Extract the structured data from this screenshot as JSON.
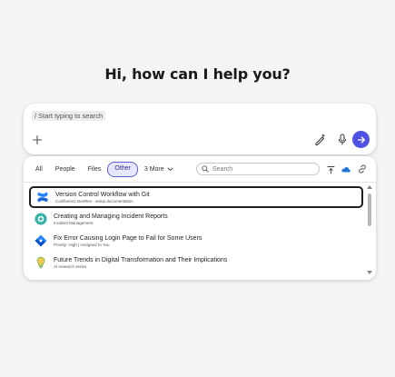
{
  "greeting": "Hi, how can I help you?",
  "composer": {
    "prompt_text": "/ Start typing to search",
    "add_icon": "plus-icon",
    "pen_icon": "pen-sparkle-icon",
    "mic_icon": "microphone-icon",
    "send_icon": "arrow-right-icon",
    "send_color": "#4f52e3"
  },
  "filters": {
    "tabs": [
      "All",
      "People",
      "Files",
      "Other"
    ],
    "active_tab": "Other",
    "more_label": "3 More",
    "search_placeholder": "Search",
    "accent": "#5b5fd6"
  },
  "results": [
    {
      "icon": "confluence-icon",
      "title": "Version Control Workflow with Git",
      "subtitle": "Confluence DevRes - setup documentation",
      "selected": true
    },
    {
      "icon": "incident-icon",
      "title": "Creating and Managing Incident Reports",
      "subtitle": "Incident Management",
      "selected": false
    },
    {
      "icon": "jira-icon",
      "title": "Fix Error Causing Login Page to Fail for Some Users",
      "subtitle": "Priority: High | Assigned to You",
      "selected": false
    },
    {
      "icon": "lightbulb-icon",
      "title": "Future Trends in Digital Transformation and Their Implications",
      "subtitle": "AI research series",
      "selected": false
    }
  ]
}
